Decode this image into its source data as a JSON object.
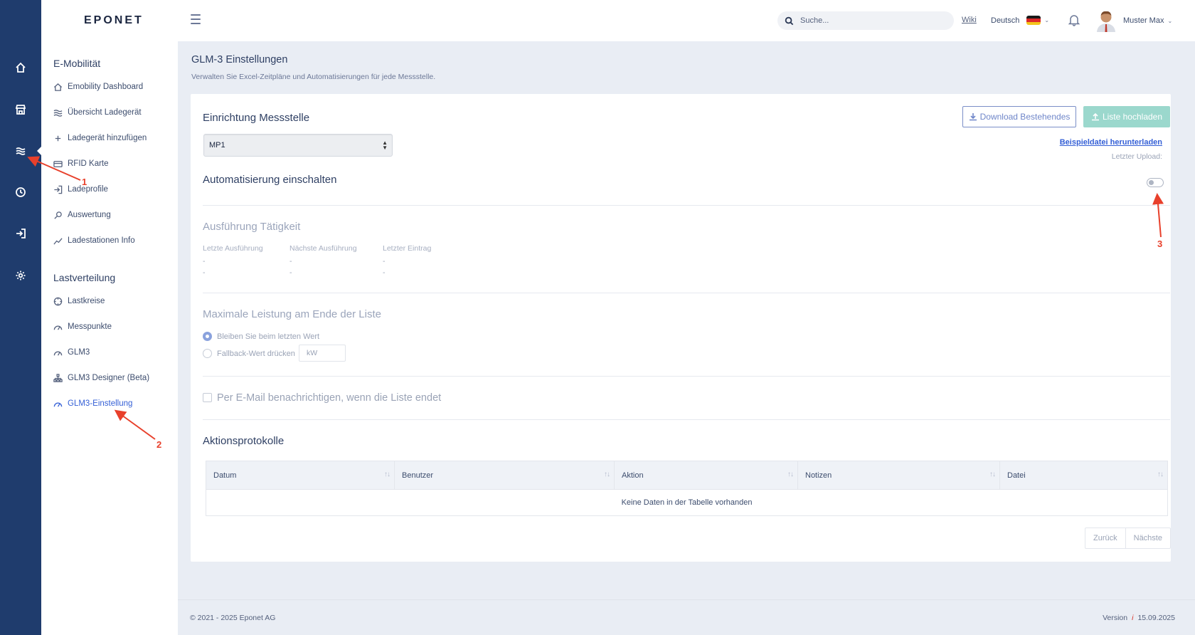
{
  "brand": {
    "logo": "EPONET"
  },
  "header": {
    "search_placeholder": "Suche...",
    "wiki_label": "Wiki",
    "language": "Deutsch",
    "user_name": "Muster Max"
  },
  "rail": {
    "items": [
      {
        "icon": "home-icon"
      },
      {
        "icon": "store-icon"
      },
      {
        "icon": "waves-icon"
      },
      {
        "icon": "clock-icon"
      },
      {
        "icon": "login-icon"
      },
      {
        "icon": "gear-icon"
      }
    ],
    "active_index": 2
  },
  "sidebar": {
    "section1": "E-Mobilität",
    "emobility_items": [
      {
        "label": "Emobility Dashboard",
        "icon": "home-outline-icon"
      },
      {
        "label": "Übersicht Ladegerät",
        "icon": "waves-icon"
      },
      {
        "label": "Ladegerät hinzufügen",
        "icon": "plus-icon"
      },
      {
        "label": "RFID Karte",
        "icon": "card-icon"
      },
      {
        "label": "Ladeprofile",
        "icon": "login-icon"
      },
      {
        "label": "Auswertung",
        "icon": "magnifier-icon"
      },
      {
        "label": "Ladestationen Info",
        "icon": "trend-icon"
      }
    ],
    "section2": "Lastverteilung",
    "last_items": [
      {
        "label": "Lastkreise",
        "icon": "circle-icon"
      },
      {
        "label": "Messpunkte",
        "icon": "gauge-icon"
      },
      {
        "label": "GLM3",
        "icon": "gauge-icon"
      },
      {
        "label": "GLM3 Designer (Beta)",
        "icon": "hierarchy-icon"
      },
      {
        "label": "GLM3-Einstellung",
        "icon": "gauge-icon",
        "active": true
      }
    ]
  },
  "page": {
    "title": "GLM-3 Einstellungen",
    "subtitle": "Verwalten Sie Excel-Zeitpläne und Automatisierungen für jede Messstelle."
  },
  "setup": {
    "heading": "Einrichtung Messstelle",
    "selected_mp": "MP1",
    "download_button": "Download Bestehendes",
    "upload_button": "Liste hochladen",
    "sample_link": "Beispieldatei herunterladen",
    "last_upload": "Letzter Upload:"
  },
  "automation": {
    "heading": "Automatisierung einschalten",
    "enabled": false
  },
  "execution": {
    "heading": "Ausführung Tätigkeit",
    "columns": [
      {
        "label": "Letzte Ausführung",
        "values": [
          "-",
          "-"
        ]
      },
      {
        "label": "Nächste Ausführung",
        "values": [
          "-",
          "-"
        ]
      },
      {
        "label": "Letzter Eintrag",
        "values": [
          "-",
          "-"
        ]
      }
    ]
  },
  "max_power": {
    "heading": "Maximale Leistung am Ende der Liste",
    "option1": "Bleiben Sie beim letzten Wert",
    "option2": "Fallback-Wert drücken",
    "selected": 1,
    "kw_placeholder": "kW"
  },
  "email": {
    "label": "Per E-Mail benachrichtigen, wenn die Liste endet",
    "checked": false
  },
  "log": {
    "heading": "Aktionsprotokolle",
    "columns": [
      "Datum",
      "Benutzer",
      "Aktion",
      "Notizen",
      "Datei"
    ],
    "empty_text": "Keine Daten in der Tabelle vorhanden",
    "prev": "Zurück",
    "next": "Nächste"
  },
  "footer": {
    "copyright": "© 2021 - 2025 Eponet AG",
    "version_label": "Version",
    "version_icon": "i",
    "version_date": "15.09.2025"
  },
  "annotations": [
    "1",
    "2",
    "3"
  ],
  "colors": {
    "rail": "#1f3c6d",
    "accent": "#3560d6",
    "upload_button": "#9bd8cd",
    "annotation": "#e8402b"
  }
}
